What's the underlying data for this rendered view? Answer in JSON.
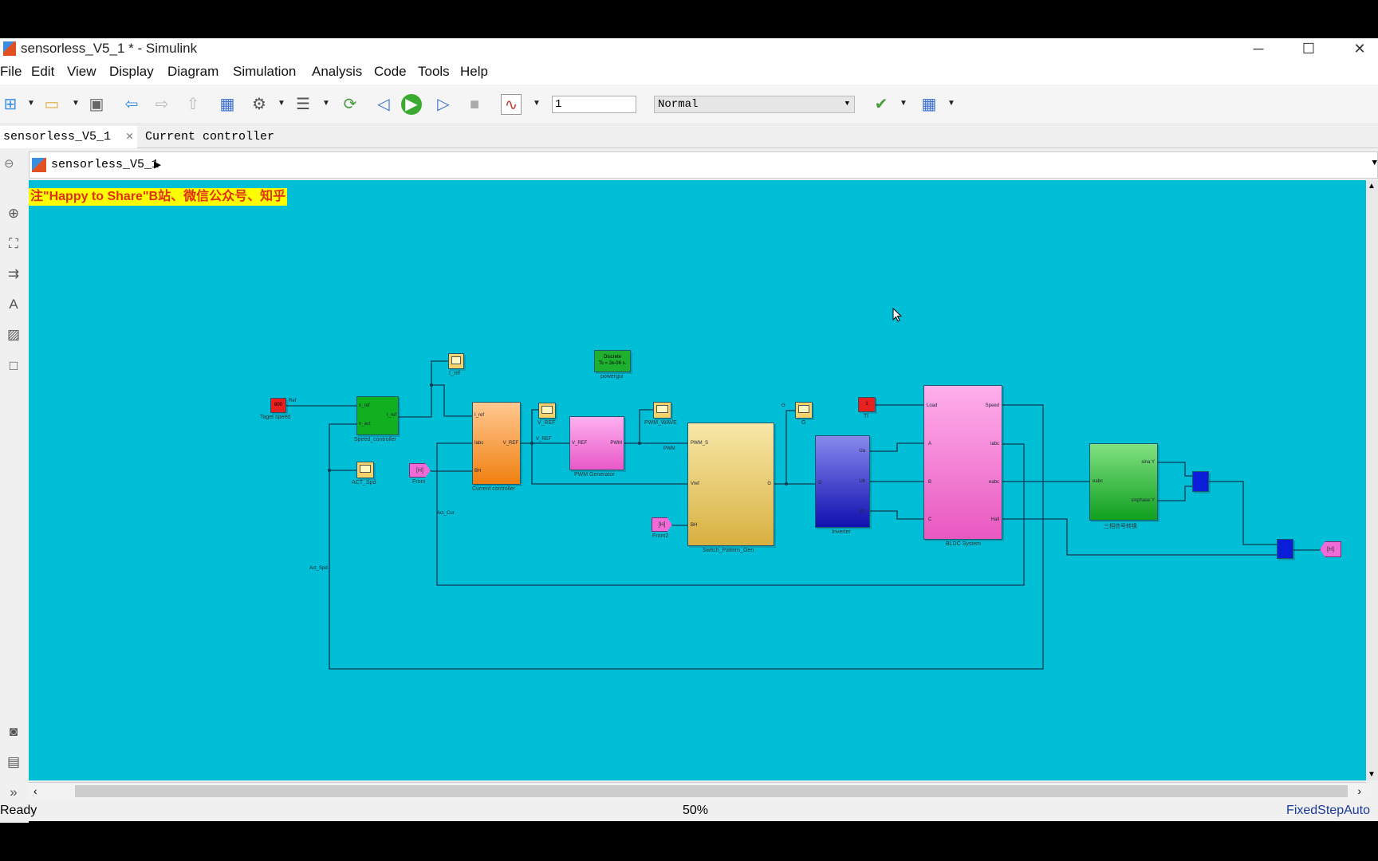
{
  "window": {
    "title": "sensorless_V5_1 * - Simulink",
    "minimize": "─",
    "maximize": "☐",
    "close": "✕"
  },
  "menu": [
    "File",
    "Edit",
    "View",
    "Display",
    "Diagram",
    "Simulation",
    "Analysis",
    "Code",
    "Tools",
    "Help"
  ],
  "toolbar": {
    "stop_time": "1",
    "sim_mode": "Normal"
  },
  "tabs": [
    {
      "label": "sensorless_V5_1",
      "close": "✕"
    },
    {
      "label": "Current controller",
      "close": "✕"
    }
  ],
  "breadcrumb": {
    "model": "sensorless_V5_1",
    "arrow": "▶"
  },
  "banner": "注\"Happy to Share\"B站、微信公众号、知乎",
  "colors": {
    "canvas": "#00bed6",
    "accent_link": "#1a3a9a"
  },
  "blocks": {
    "target_speed": {
      "label": "Taget speed",
      "value": "800"
    },
    "speed_controller": {
      "label": "Speed_controller",
      "in": [
        "n_ref",
        "n_act"
      ],
      "out": [
        "I_ref"
      ]
    },
    "i_ref_scope": {
      "label": "I_ref"
    },
    "act_spd_scope": {
      "label": "ACT_Spd"
    },
    "from": {
      "label": "From",
      "tag": "[H]"
    },
    "current_controller": {
      "label": "Current controller",
      "in": [
        "I_ref",
        "Iabc",
        "BH"
      ],
      "out": [
        "V_REF"
      ]
    },
    "v_ref_scope": {
      "label": "V_REF"
    },
    "powergui": {
      "label": "powergui",
      "text": "Discrete\nTs = 2e-06 s."
    },
    "pwm_generator": {
      "label": "PWM Generator",
      "in": [
        "V_REF"
      ],
      "out": [
        "PWM"
      ]
    },
    "pwm_wave_scope": {
      "label": "PWM_WAVE"
    },
    "switch_pattern_gen": {
      "label": "Switch_Pattern_Gen",
      "in": [
        "PWM_S",
        "Vref",
        "BH"
      ],
      "out": [
        "G"
      ]
    },
    "from2": {
      "label": "From2",
      "tag": "[H]"
    },
    "g_scope": {
      "label": "G"
    },
    "tl": {
      "label": "Tl",
      "value": "1"
    },
    "inverter": {
      "label": "Inverter",
      "in": [
        "G"
      ],
      "out": [
        "Ua",
        "Ub",
        "Uc"
      ]
    },
    "bldc": {
      "label": "BLDC System",
      "in": [
        "Load",
        "A",
        "B",
        "C"
      ],
      "out": [
        "Speed",
        "iabc",
        "eabc",
        "Hall"
      ]
    },
    "converter": {
      "label": "三相信号转换",
      "in": [
        "eabc"
      ],
      "out": [
        "sina Y",
        "sinphase Y"
      ]
    },
    "goto": {
      "tag": "[H]"
    }
  },
  "signals": {
    "ref": "Ref",
    "v_ref": "V_REF",
    "pwm": "PWM",
    "g": "G",
    "act_cur": "Act_Cur",
    "act_spd": "Act_Spd"
  },
  "status": {
    "left": "Ready",
    "zoom": "50%",
    "solver": "FixedStepAuto"
  }
}
